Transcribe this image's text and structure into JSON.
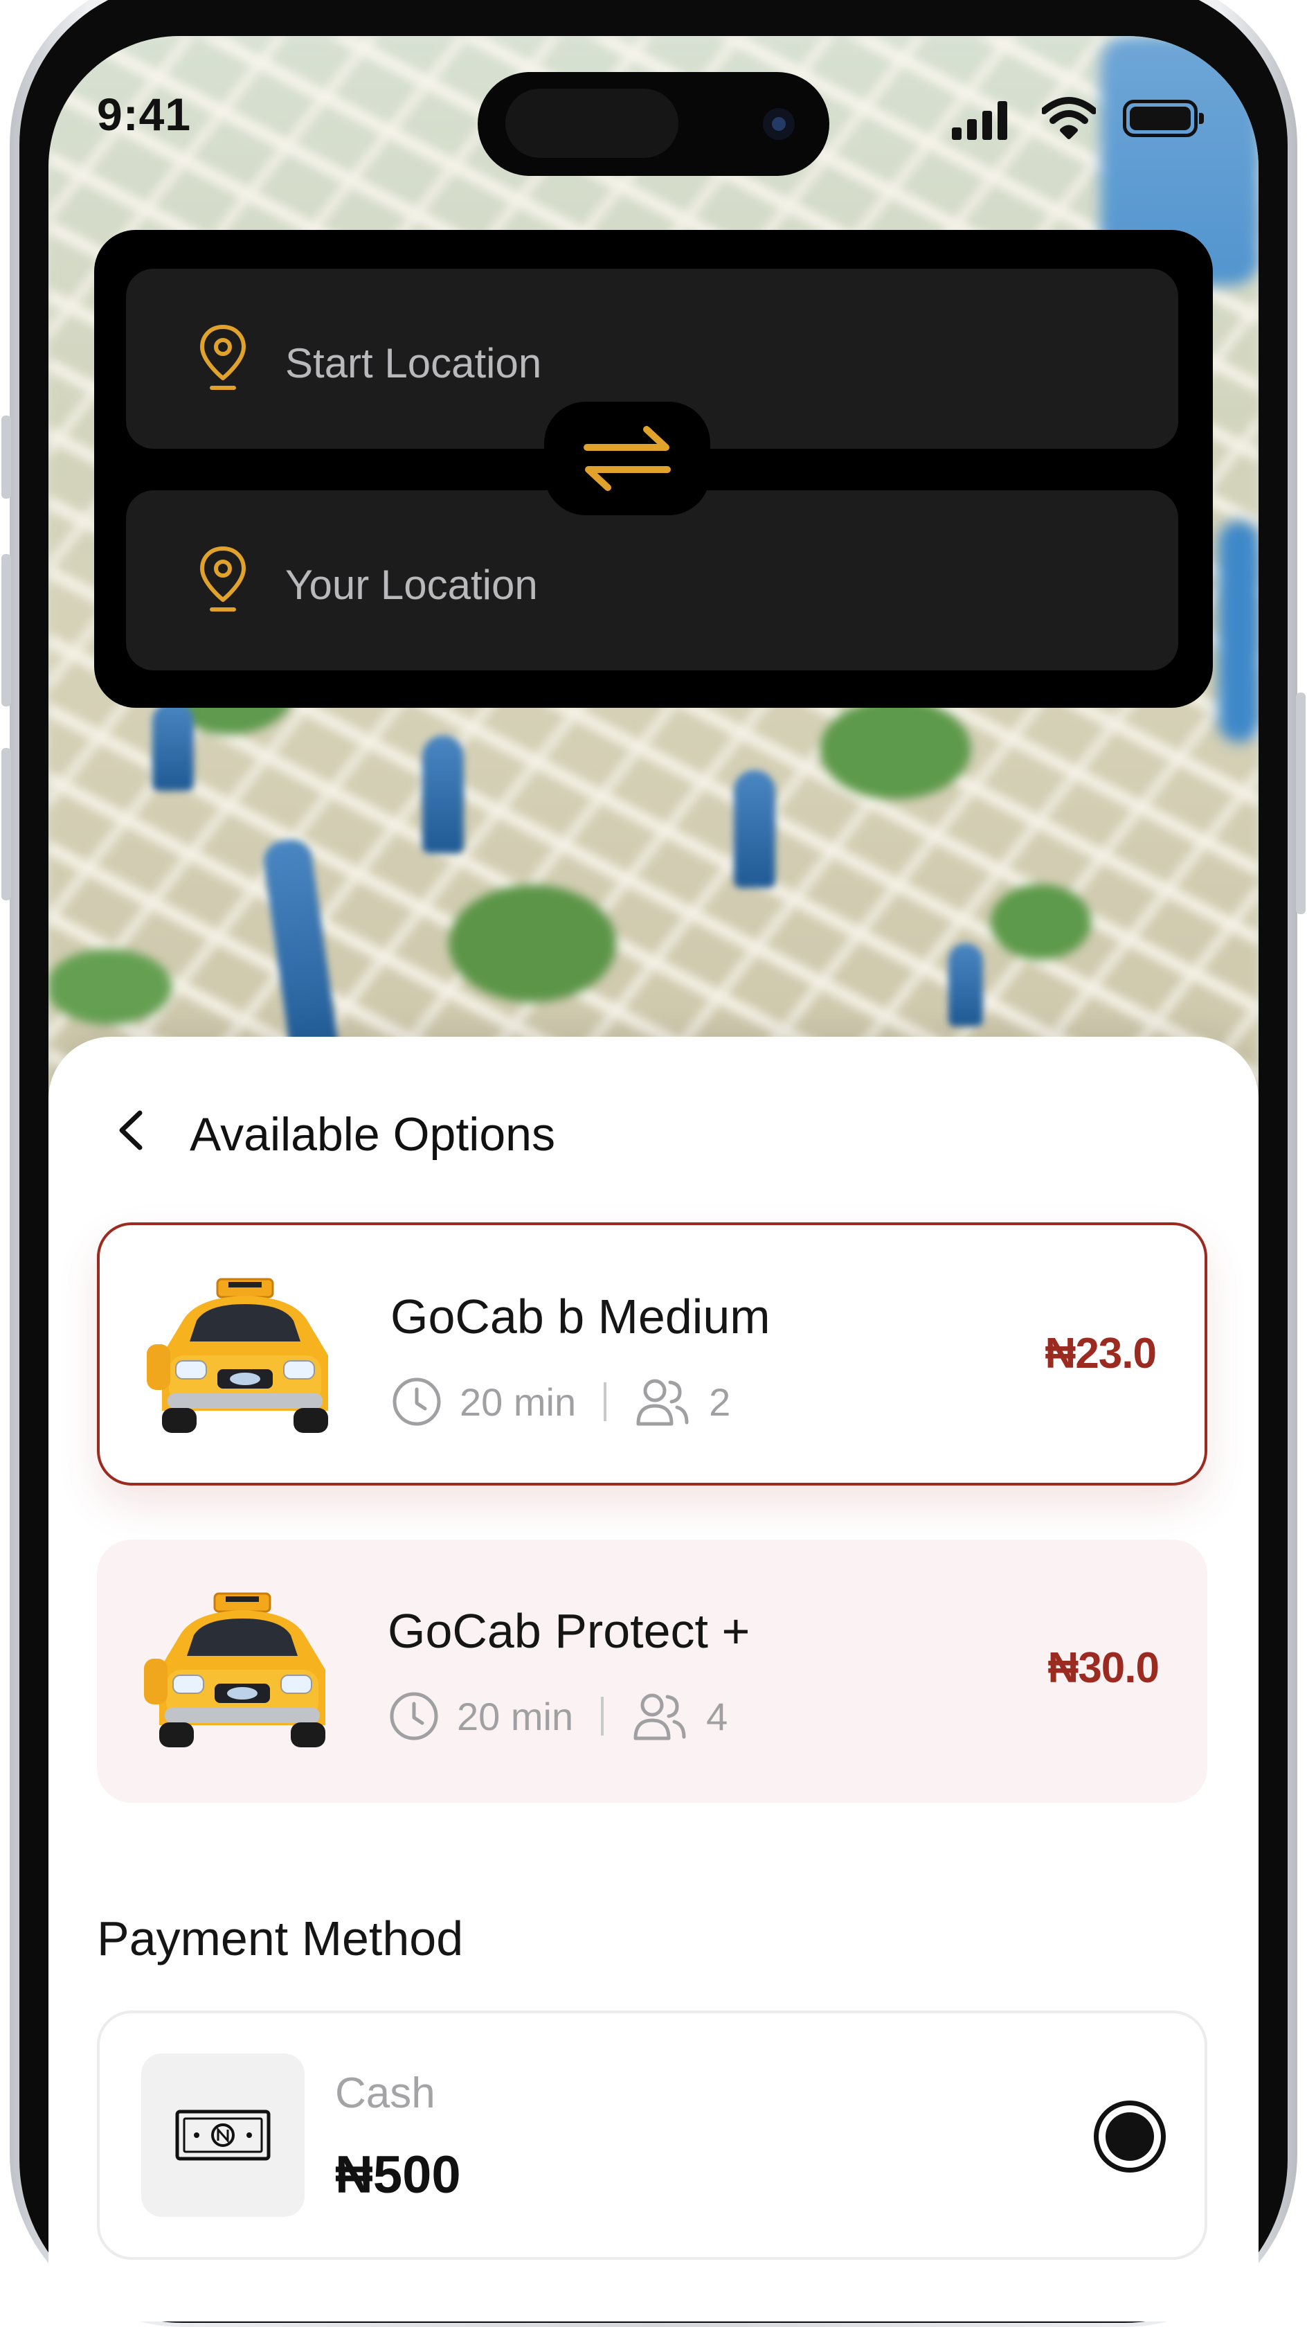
{
  "status_bar": {
    "time": "9:41"
  },
  "location_card": {
    "start_placeholder": "Start Location",
    "destination_placeholder": "Your Location"
  },
  "sheet": {
    "title": "Available Options",
    "options": [
      {
        "name": "GoCab b Medium",
        "eta": "20 min",
        "seats": "2",
        "price": "₦23.0",
        "selected": true
      },
      {
        "name": "GoCab Protect +",
        "eta": "20 min",
        "seats": "4",
        "price": "₦30.0",
        "selected": false
      }
    ],
    "payment": {
      "title": "Payment Method",
      "method_label": "Cash",
      "amount": "₦500",
      "selected": true
    }
  },
  "colors": {
    "accent": "#9b2a20",
    "pin": "#e0a22a",
    "card_dark": "#000000",
    "field_dark": "#1c1c1d",
    "selected_option_bg": "#ffffff",
    "unselected_option_bg": "#fbf3f3"
  },
  "icons": [
    "location-pin-icon",
    "swap-icon",
    "chevron-left-icon",
    "taxi-icon",
    "clock-icon",
    "users-icon",
    "cash-icon",
    "radio-selected-icon",
    "signal-icon",
    "wifi-icon",
    "battery-icon"
  ]
}
